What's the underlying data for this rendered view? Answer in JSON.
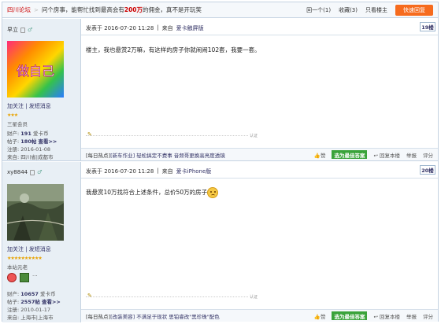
{
  "topbar": {
    "forum": "四川论坛",
    "tips_pre": "问个房事，能帮忙找到最高会有",
    "tips_amount": "200万",
    "tips_post": "的佣金，真不是开玩笑",
    "tool_prev": "回一个(1)",
    "tool_fav": "收藏(3)",
    "tool_only_op": "只看楼主",
    "reply_button": "快速回复"
  },
  "posts": [
    {
      "user": "早立",
      "links": "加关注 | 发短消息",
      "rank": "三星会员",
      "stars": "★★★",
      "stats": [
        {
          "label": "财产:",
          "value": "191",
          "extra": "爱卡币"
        },
        {
          "label": "帖子:",
          "value": "180帖",
          "extra": "查看>>"
        },
        {
          "label": "注册:",
          "value": "2016-01-08",
          "extra": ""
        },
        {
          "label": "来自:",
          "value": "四川省|成都市",
          "extra": ""
        }
      ],
      "posted_at": "发表于 2016-07-20 11:28",
      "source_pre": "来自",
      "source": "爱卡触屏版",
      "floor": "19楼",
      "content": "楼主，我也悬赏2万嘛，有这样的房子你就闹闹102套，我要一套。",
      "sig": "认证",
      "hot_label": "[每日热点]",
      "hot_tag": "[新车作业]",
      "hot_text": "轻松搞定不费事 音频哥更换高亮度透镜",
      "like": "赞",
      "best": "选为最佳答案",
      "reply": "回复本楼",
      "report": "举报",
      "score": "评分"
    },
    {
      "user": "xy8844",
      "links": "加关注 | 发短消息",
      "rank": "本站元老",
      "stars": "★★★★★★★★★★",
      "stats": [
        {
          "label": "财产:",
          "value": "10657",
          "extra": "爱卡币"
        },
        {
          "label": "帖子:",
          "value": "2557帖",
          "extra": "查看>>"
        },
        {
          "label": "注册:",
          "value": "2010-01-17",
          "extra": ""
        },
        {
          "label": "来自:",
          "value": "上海市|上海市",
          "extra": ""
        }
      ],
      "posted_at": "发表于 2016-07-20 11:28",
      "source_pre": "来自",
      "source": "爱卡iPhone版",
      "floor": "20楼",
      "content": "我悬赏10万找符合上述条件，总价50万的房子",
      "sig": "认证",
      "hot_label": "[每日热点]",
      "hot_tag": "[改装美容]",
      "hot_text": "不满足于现状 思铂睿改\"黑珍珠\"配色",
      "like": "赞",
      "best": "选为最佳答案",
      "reply": "回复本楼",
      "report": "举报",
      "score": "评分"
    }
  ],
  "avatar1_text": "做自己",
  "colors": {
    "accent": "#f66b1e",
    "best": "#3aa33a",
    "link": "#333366",
    "border": "#c5d3e2"
  }
}
